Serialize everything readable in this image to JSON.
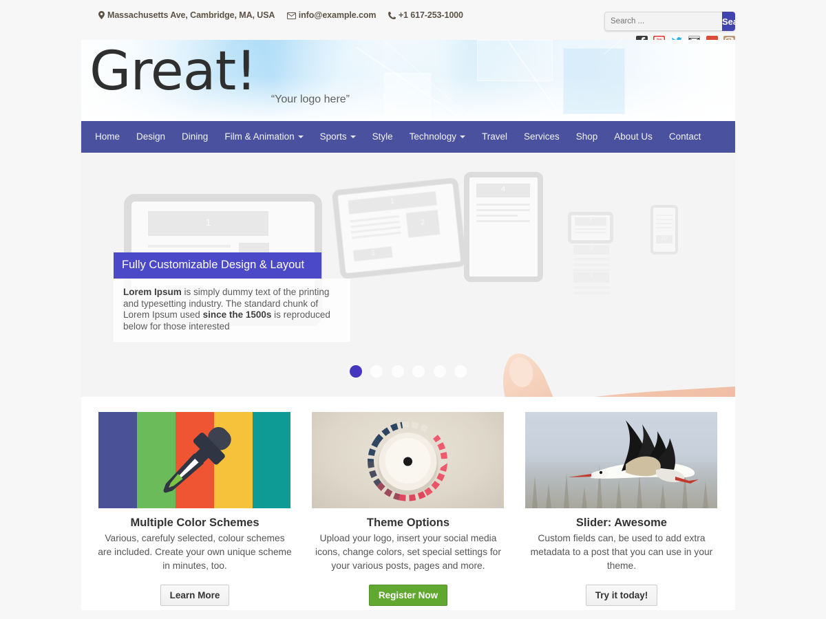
{
  "topbar": {
    "address": "Massachusetts Ave, Cambridge, MA, USA",
    "email": "info@example.com",
    "phone": "+1 617-253-1000",
    "icons": {
      "location": "map-pin-icon",
      "mail": "envelope-icon",
      "phone": "phone-icon"
    }
  },
  "search": {
    "placeholder": "Search ...",
    "value": "",
    "button_label": "Search",
    "button_color": "#4244ae"
  },
  "socials": [
    {
      "name": "facebook",
      "label": "f",
      "color": "#3b3b3b"
    },
    {
      "name": "youtube",
      "label": "You Tube",
      "color": "#e02f2f"
    },
    {
      "name": "twitter",
      "label": "t",
      "color": "#ffffff"
    },
    {
      "name": "email",
      "label": "envelope",
      "color": "#ffffff"
    },
    {
      "name": "googleplus",
      "label": "g+",
      "color": "#dd4b39"
    },
    {
      "name": "instagram",
      "label": "ig",
      "color": "#b99b7a"
    }
  ],
  "logo": {
    "text": "Great!",
    "tagline": "“Your logo here”"
  },
  "nav": {
    "background": "#4a52a0",
    "items": [
      {
        "label": "Home",
        "dropdown": false
      },
      {
        "label": "Design",
        "dropdown": false
      },
      {
        "label": "Dining",
        "dropdown": false
      },
      {
        "label": "Film & Animation",
        "dropdown": true
      },
      {
        "label": "Sports",
        "dropdown": true
      },
      {
        "label": "Style",
        "dropdown": false
      },
      {
        "label": "Technology",
        "dropdown": true
      },
      {
        "label": "Travel",
        "dropdown": false
      },
      {
        "label": "Services",
        "dropdown": false
      },
      {
        "label": "Shop",
        "dropdown": false
      },
      {
        "label": "About Us",
        "dropdown": false
      },
      {
        "label": "Contact",
        "dropdown": false
      }
    ]
  },
  "slider": {
    "caption_title": "Fully Customizable Design & Layout",
    "caption_title_color": "#4c49c9",
    "caption_lead": "Lorem Ipsum",
    "caption_mid": " is simply dummy text of the printing and typesetting industry. The standard chunk of Lorem Ipsum used ",
    "caption_bold2": "since the 1500s",
    "caption_tail": " is reproduced below for those interested",
    "device_numbers": [
      "1",
      "2",
      "3",
      "4",
      "7",
      "8",
      "9",
      "10"
    ],
    "dots": {
      "count": 6,
      "active_index": 0,
      "active_color": "#4536c0"
    }
  },
  "features": [
    {
      "media": "color-swatches-eyedropper-image",
      "swatch_colors": [
        "#4b5196",
        "#6cbb5a",
        "#ef5532",
        "#f6c23b",
        "#0f9b95"
      ],
      "title": "Multiple Color Schemes",
      "text": "Various, carefuly selected, colour schemes are included. Create your own unique scheme in minutes, too.",
      "button": "Learn More",
      "button_style": "grey"
    },
    {
      "media": "dial-knob-image",
      "title": "Theme Options",
      "text": "Upload your logo, insert your social media icons, change colors, set special settings for your various posts, pages and more.",
      "button": "Register Now",
      "button_style": "green",
      "button_color": "#60a830"
    },
    {
      "media": "flying-stork-image",
      "title": "Slider: Awesome",
      "text": "Custom fields can, be used to add extra metadata to a post that you can use in your theme.",
      "button": "Try it today!",
      "button_style": "grey"
    }
  ]
}
